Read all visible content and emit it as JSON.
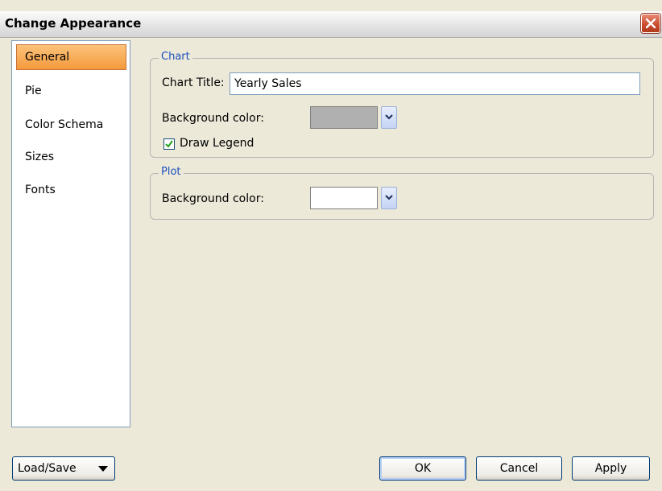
{
  "window": {
    "title": "Change Appearance"
  },
  "sidebar": {
    "items": [
      {
        "label": "General",
        "active": true
      },
      {
        "label": "Pie",
        "active": false
      },
      {
        "label": "Color Schema",
        "active": false
      },
      {
        "label": "Sizes",
        "active": false
      },
      {
        "label": "Fonts",
        "active": false
      }
    ]
  },
  "chart_group": {
    "legend": "Chart",
    "title_label": "Chart Title:",
    "title_value": "Yearly Sales",
    "bg_label": "Background color:",
    "bg_color": "#b0b0b0",
    "draw_legend_label": "Draw Legend",
    "draw_legend_checked": true
  },
  "plot_group": {
    "legend": "Plot",
    "bg_label": "Background color:",
    "bg_color": "#ffffff"
  },
  "footer": {
    "load_save_label": "Load/Save",
    "ok_label": "OK",
    "cancel_label": "Cancel",
    "apply_label": "Apply"
  },
  "colors": {
    "active_nav": "#f7a54b",
    "group_legend": "#1c4fc0",
    "close_button": "#c94a2c"
  }
}
